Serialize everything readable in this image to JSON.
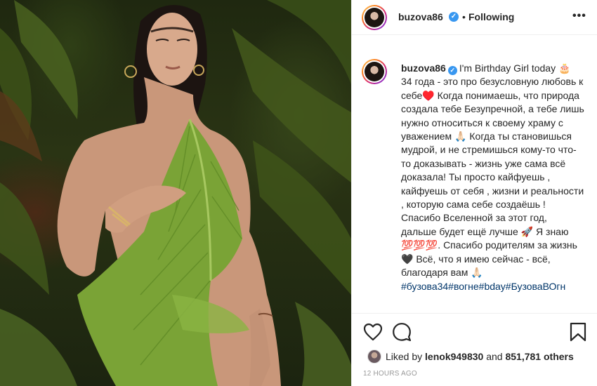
{
  "post": {
    "username": "buzova86",
    "verified_mark": "✓",
    "separator": "•",
    "follow_status": "Following",
    "more_glyph": "•••",
    "caption": {
      "username": "buzova86",
      "text": "I'm Birthday Girl today 🎂\n34 года - это про безусловную любовь к себе♥️ Когда понимаешь, что природа создала тебе Безупречной, а тебе лишь нужно относиться к своему храму с уважением 🙏🏻 Когда ты становишься мудрой, и не стремишься кому-то что-то доказывать - жизнь уже сама всё доказала! Ты просто кайфуешь , кайфуешь от себя , жизни и реальности , которую сама себе создаёшь ! Спасибо Вселенной за этот год, дальше будет ещё лучше 🚀 Я знаю 💯💯💯. Спасибо родителям за жизнь 🖤 Всё, что я имею сейчас - всё, благодаря вам 🙏🏻",
      "hashtags": "#бузова34#вогне#bday#БузоваВОгн"
    },
    "likes": {
      "prefix": "Liked by",
      "user": "lenok949830",
      "conjunction": "and",
      "others": "851,781 others"
    },
    "timestamp": "12 HOURS AGO"
  },
  "icons": {
    "like": "heart-outline-icon",
    "comment": "comment-bubble-icon",
    "save": "bookmark-icon",
    "verified": "verified-badge-icon",
    "more": "more-options-icon"
  },
  "colors": {
    "verified_blue": "#3897f0",
    "hashtag_blue": "#003569",
    "text": "#262626",
    "muted": "#999999",
    "divider": "#efefef"
  }
}
